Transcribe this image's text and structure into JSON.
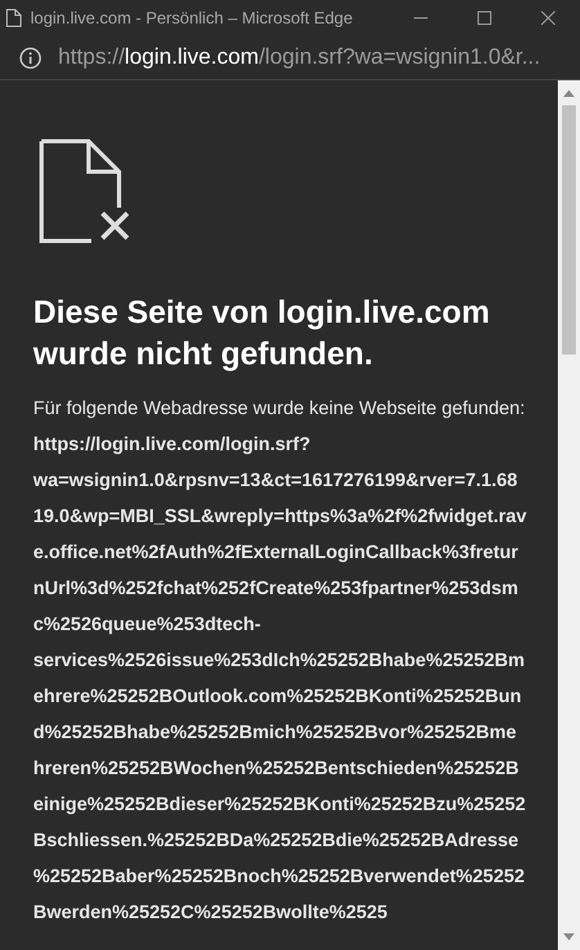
{
  "window": {
    "title": "login.live.com - Persönlich – Microsoft Edge"
  },
  "address_bar": {
    "scheme": "https://",
    "host": "login.live.com",
    "path": "/login.srf?wa=wsignin1.0&r..."
  },
  "heading": "Diese Seite von login.live.com wurde nicht gefunden.",
  "message": "Für folgende Webadresse wurde keine Webseite gefunden: **https://login.live.com/login.srf?wa=wsignin1.0&rpsnv=13&ct=1617276199&rver=7.1.6819.0&wp=MBI_SSL&wreply=https%3a%2f%2fwidget.rave.office.net%2fAuth%2fExternalLoginCallback%3freturnUrl%3d%252fchat%252fCreate%253fpartner%253dsmc%2526queue%253dtech-services%2526issue%253dIch%25252Bhabe%25252Bmehrere%25252BOutlook.com%25252BKonti%25252Bund%25252Bhabe%25252Bmich%25252Bvor%25252Bmehreren%25252BWochen%25252Bentschieden%25252Beinige%25252Bdieser%25252BKonti%25252Bzu%25252Bschliessen.%25252BDa%25252Bdie%25252BAdresse%25252Baber%25252Bnoch%25252Bverwendet%25252Bwerden%25252C%25252Bwollte%2525**"
}
